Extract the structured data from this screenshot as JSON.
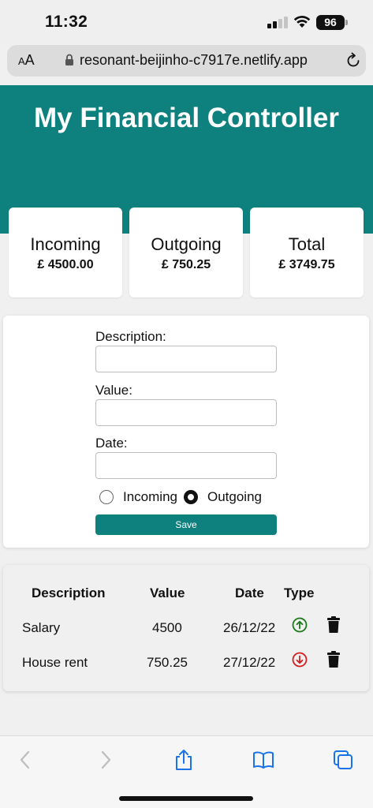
{
  "status_bar": {
    "time": "11:32",
    "battery": "96"
  },
  "browser": {
    "aa_label_small": "A",
    "aa_label": "A",
    "url": "resonant-beijinho-c7917e.netlify.app"
  },
  "app": {
    "title": "My Financial Controller"
  },
  "summary": {
    "incoming": {
      "label": "Incoming",
      "amount": "£ 4500.00"
    },
    "outgoing": {
      "label": "Outgoing",
      "amount": "£ 750.25"
    },
    "total": {
      "label": "Total",
      "amount": "£ 3749.75"
    }
  },
  "form": {
    "description_label": "Description:",
    "description_value": "",
    "value_label": "Value:",
    "value_value": "",
    "date_label": "Date:",
    "date_value": "",
    "radio_incoming": "Incoming",
    "radio_outgoing": "Outgoing",
    "selected_type": "Outgoing",
    "save_label": "Save"
  },
  "table": {
    "headers": [
      "Description",
      "Value",
      "Date",
      "Type"
    ],
    "rows": [
      {
        "description": "Salary",
        "value": "4500",
        "date": "26/12/22",
        "type": "incoming",
        "type_icon": "arrow-up-circle-icon"
      },
      {
        "description": "House rent",
        "value": "750.25",
        "date": "27/12/22",
        "type": "outgoing",
        "type_icon": "arrow-down-circle-icon"
      }
    ]
  },
  "colors": {
    "brand": "#0e807e",
    "incoming": "#1a7a1a",
    "outgoing": "#d21f1f"
  }
}
